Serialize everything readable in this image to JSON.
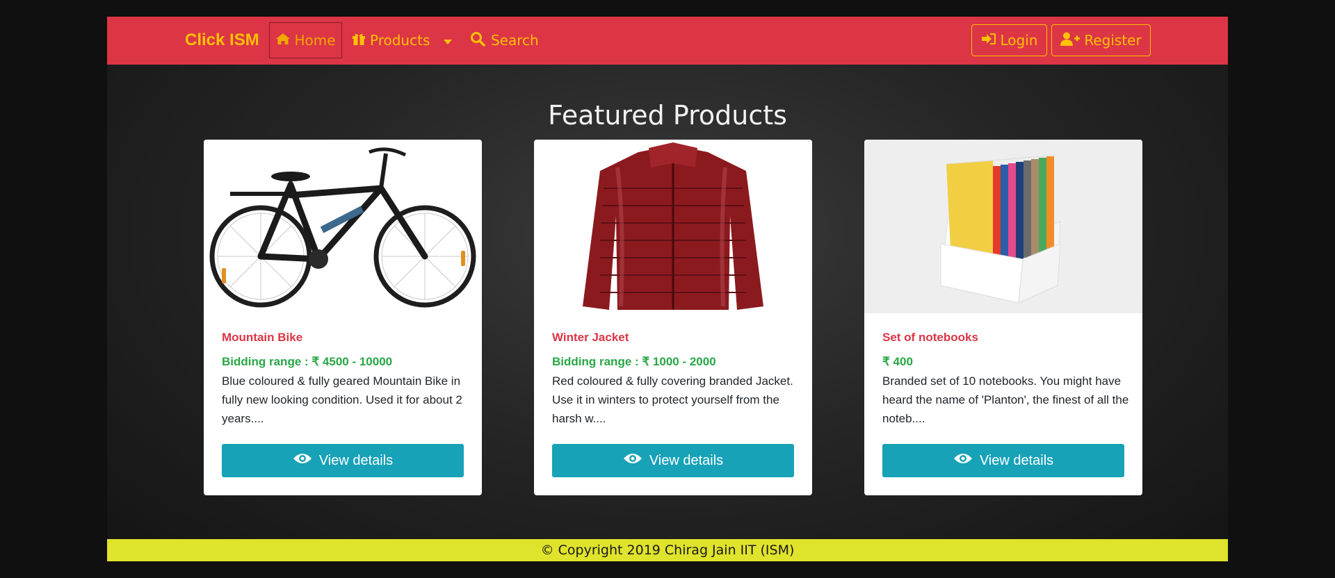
{
  "navbar": {
    "brand": "Click ISM",
    "home_label": "Home",
    "products_label": "Products",
    "search_label": "Search",
    "login_label": "Login",
    "register_label": "Register",
    "colors": {
      "background": "#dc3545",
      "text": "#ffc107"
    }
  },
  "main": {
    "title": "Featured Products",
    "products": [
      {
        "name": "Mountain Bike",
        "price": "Bidding range : ₹ 4500 - 10000",
        "description": "Blue coloured & fully geared Mountain Bike in fully new looking condition. Used it for about 2 years....",
        "button_label": "View details",
        "image_icon": "bicycle-image"
      },
      {
        "name": "Winter Jacket",
        "price": "Bidding range : ₹ 1000 - 2000",
        "description": "Red coloured & fully covering branded Jacket. Use it in winters to protect yourself from the harsh w....",
        "button_label": "View details",
        "image_icon": "jacket-image"
      },
      {
        "name": "Set of notebooks",
        "price": "₹ 400",
        "description": "Branded set of 10 notebooks. You might have heard the name of 'Planton', the finest of all the noteb....",
        "button_label": "View details",
        "image_icon": "notebooks-image"
      }
    ],
    "colors": {
      "title": "#dc3545",
      "price": "#28a745",
      "button": "#17a2b8"
    }
  },
  "footer": {
    "text": "© Copyright 2019 Chirag Jain IIT (ISM)",
    "color": "#dfe32b"
  }
}
